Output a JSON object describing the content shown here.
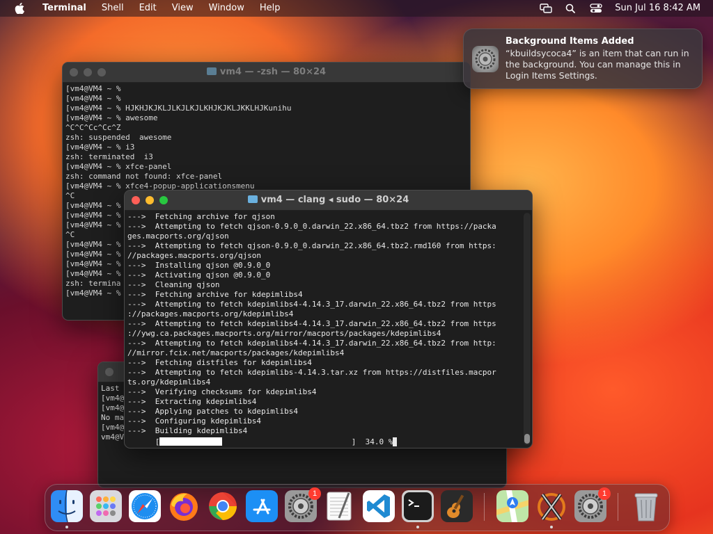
{
  "menubar": {
    "app": "Terminal",
    "items": [
      "Shell",
      "Edit",
      "View",
      "Window",
      "Help"
    ],
    "clock": "Sun Jul 16  8:42 AM",
    "status_icons": [
      "screen-mirroring-icon",
      "search-icon",
      "control-center-icon"
    ]
  },
  "notification": {
    "title": "Background Items Added",
    "body": "“kbuildsycoca4” is an item that can run in the background. You can manage this in Login Items Settings.",
    "icon": "system-settings-gear-icon"
  },
  "win_back": {
    "title": "vm4 — -zsh — 80×24",
    "lines": [
      "[vm4@VM4 ~ %",
      "[vm4@VM4 ~ %",
      "[vm4@VM4 ~ % HJKHJKJKLJLKJLKJLKHJKJKLJKKLHJKunihu",
      "[vm4@VM4 ~ % awesome",
      "^C^C^Cc^Cc^Z",
      "zsh: suspended  awesome",
      "[vm4@VM4 ~ % i3",
      "zsh: terminated  i3",
      "[vm4@VM4 ~ % xfce-panel",
      "zsh: command not found: xfce-panel",
      "[vm4@VM4 ~ % xfce4-popup-applicationsmenu",
      "^C",
      "[vm4@VM4 ~ %",
      "[vm4@VM4 ~ %",
      "[vm4@VM4 ~ %",
      "^C",
      "[vm4@VM4 ~ %",
      "[vm4@VM4 ~ %",
      "[vm4@VM4 ~ %",
      "[vm4@VM4 ~ %",
      "zsh: termina",
      "[vm4@VM4 ~ %"
    ]
  },
  "win_third": {
    "lines": [
      "Last",
      "[vm4@V",
      "[vm4@V",
      "No ma",
      "[vm4@V",
      "vm4@V"
    ]
  },
  "win_front": {
    "title": "vm4 — clang ◂ sudo — 80×24",
    "lines": [
      "--->  Fetching archive for qjson",
      "--->  Attempting to fetch qjson-0.9.0_0.darwin_22.x86_64.tbz2 from https://packa",
      "ges.macports.org/qjson",
      "--->  Attempting to fetch qjson-0.9.0_0.darwin_22.x86_64.tbz2.rmd160 from https:",
      "//packages.macports.org/qjson",
      "--->  Installing qjson @0.9.0_0",
      "--->  Activating qjson @0.9.0_0",
      "--->  Cleaning qjson",
      "--->  Fetching archive for kdepimlibs4",
      "--->  Attempting to fetch kdepimlibs4-4.14.3_17.darwin_22.x86_64.tbz2 from https",
      "://packages.macports.org/kdepimlibs4",
      "--->  Attempting to fetch kdepimlibs4-4.14.3_17.darwin_22.x86_64.tbz2 from https",
      "://ywg.ca.packages.macports.org/mirror/macports/packages/kdepimlibs4",
      "--->  Attempting to fetch kdepimlibs4-4.14.3_17.darwin_22.x86_64.tbz2 from http:",
      "//mirror.fcix.net/macports/packages/kdepimlibs4",
      "--->  Fetching distfiles for kdepimlibs4",
      "--->  Attempting to fetch kdepimlibs-4.14.3.tar.xz from https://distfiles.macpor",
      "ts.org/kdepimlibs4",
      "--->  Verifying checksums for kdepimlibs4",
      "--->  Extracting kdepimlibs4",
      "--->  Applying patches to kdepimlibs4",
      "--->  Configuring kdepimlibs4",
      "--->  Building kdepimlibs4"
    ],
    "progress_prefix": "      [",
    "progress_suffix": "                            ]  34.0 %",
    "progress_percent": 34.0
  },
  "dock": {
    "apps": [
      {
        "name": "Finder",
        "icon": "finder-icon",
        "running": true
      },
      {
        "name": "Launchpad",
        "icon": "launchpad-icon"
      },
      {
        "name": "Safari",
        "icon": "safari-icon"
      },
      {
        "name": "Firefox",
        "icon": "firefox-icon"
      },
      {
        "name": "Chrome",
        "icon": "chrome-icon"
      },
      {
        "name": "App Store",
        "icon": "app-store-icon"
      },
      {
        "name": "System Settings",
        "icon": "system-settings-icon",
        "badge": "1"
      },
      {
        "name": "TextEdit",
        "icon": "textedit-icon"
      },
      {
        "name": "Visual Studio Code",
        "icon": "vscode-icon"
      },
      {
        "name": "Terminal",
        "icon": "terminal-icon",
        "running": true
      },
      {
        "name": "GarageBand",
        "icon": "garageband-icon"
      },
      {
        "name": "Maps",
        "icon": "maps-icon"
      },
      {
        "name": "XQuartz",
        "icon": "xquartz-icon",
        "running": true
      },
      {
        "name": "System Settings",
        "icon": "system-settings-icon",
        "badge": "1"
      },
      {
        "name": "Trash",
        "icon": "trash-icon"
      }
    ],
    "badge_settings": "1",
    "badge_settings2": "1"
  }
}
